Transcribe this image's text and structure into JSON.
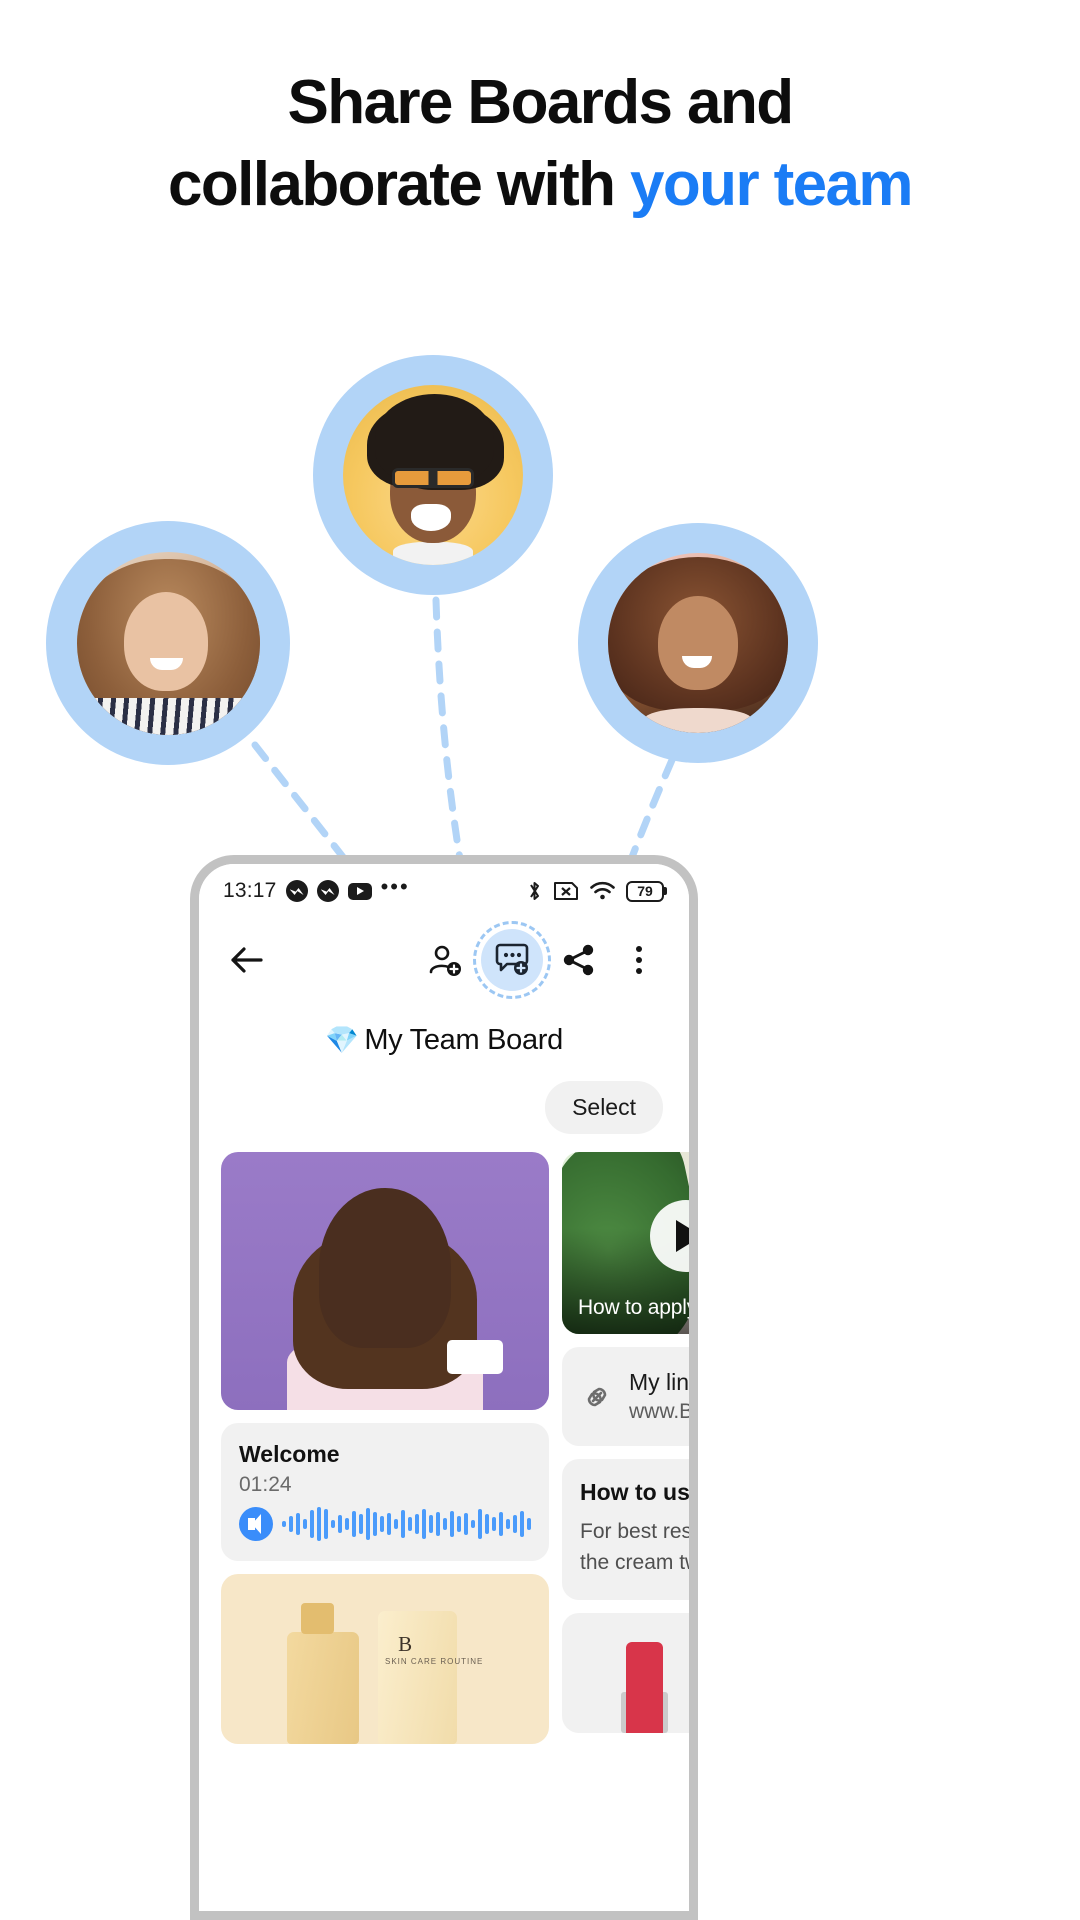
{
  "headline": {
    "line1": "Share Boards and",
    "line2_prefix": "collaborate with ",
    "line2_accent": "your team",
    "accent_color": "#1a7cf5",
    "text_color": "#0d0d0d"
  },
  "avatars": [
    {
      "name": "team-member-left",
      "alt": "Smiling woman with wavy hair",
      "ring_color": "#b2d4f7"
    },
    {
      "name": "team-member-center",
      "alt": "Laughing man with glasses",
      "ring_color": "#b2d4f7"
    },
    {
      "name": "team-member-right",
      "alt": "Smiling woman with curly hair",
      "ring_color": "#b2d4f7"
    }
  ],
  "connector": {
    "color": "#b2d4f7",
    "style": "dashed"
  },
  "phone": {
    "status_bar": {
      "time": "13:17",
      "left_icons": [
        "messenger-icon",
        "messenger-icon",
        "youtube-icon",
        "more-notifications-icon"
      ],
      "right_icons": [
        "bluetooth-icon",
        "no-sim-icon",
        "wifi-icon",
        "battery-icon"
      ],
      "battery_level": "79"
    },
    "toolbar": {
      "back_label": "Back",
      "add_person_label": "Add person",
      "add_comment_label": "Add comment",
      "share_label": "Share",
      "more_label": "More options",
      "highlight_color": "#cfe4fb",
      "highlight_ring_color": "#9cc7f3"
    },
    "board": {
      "emoji": "💎",
      "title": "My Team Board",
      "select_label": "Select"
    },
    "cards": {
      "portrait": {
        "alt": "Woman holding a cream jar on purple background"
      },
      "video": {
        "caption": "How to apply the ne...",
        "play_label": "Play"
      },
      "audio": {
        "title": "Welcome",
        "duration": "01:24",
        "bars": [
          6,
          16,
          22,
          10,
          28,
          34,
          30,
          8,
          18,
          12,
          26,
          20,
          32,
          24,
          16,
          22,
          10,
          28,
          14,
          20,
          30,
          18,
          24,
          12,
          26,
          16,
          22,
          8,
          30,
          20,
          14,
          24,
          10,
          18,
          26,
          12
        ]
      },
      "link": {
        "title": "My link",
        "url": "www.Boards.com"
      },
      "note": {
        "title": "How to use",
        "body": "For best results, apply the cream twice a day"
      },
      "product": {
        "brand": "B",
        "subtitle": "SKIN CARE ROUTINE"
      },
      "lipstick": {
        "alt": "Red lipstick"
      }
    }
  }
}
